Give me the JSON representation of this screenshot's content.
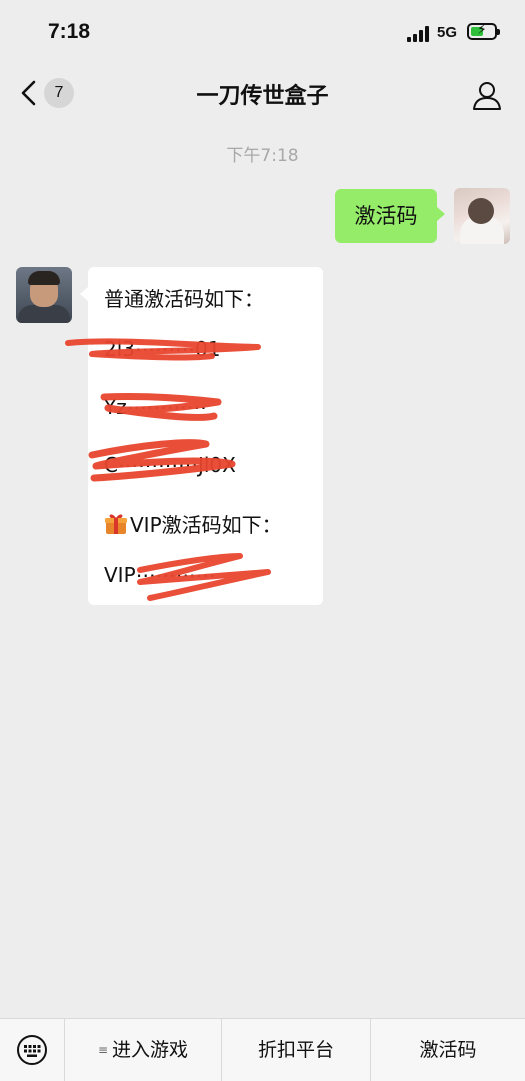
{
  "status_bar": {
    "time": "7:18",
    "network": "5G"
  },
  "nav": {
    "unread_count": "7",
    "title": "一刀传世盒子"
  },
  "chat": {
    "timestamp": "下午7:18",
    "outgoing_message": "激活码",
    "incoming": {
      "line1": "普通激活码如下：",
      "code1": "2l3⋯⋯⋯01",
      "code2": "Yz⋯⋯⋯⋯",
      "code3": "C⋯⋯⋯⋯Jl0X",
      "vip_heading": "VIP激活码如下：",
      "vip_code": "VIP⋯⋯⋯⋯"
    }
  },
  "bottom_menu": {
    "items": [
      {
        "label": "进入游戏",
        "has_submenu": true
      },
      {
        "label": "折扣平台"
      },
      {
        "label": "激活码"
      }
    ]
  },
  "colors": {
    "outgoing_bubble": "#95ec69",
    "background": "#ededed",
    "scribble": "#e8462e"
  }
}
